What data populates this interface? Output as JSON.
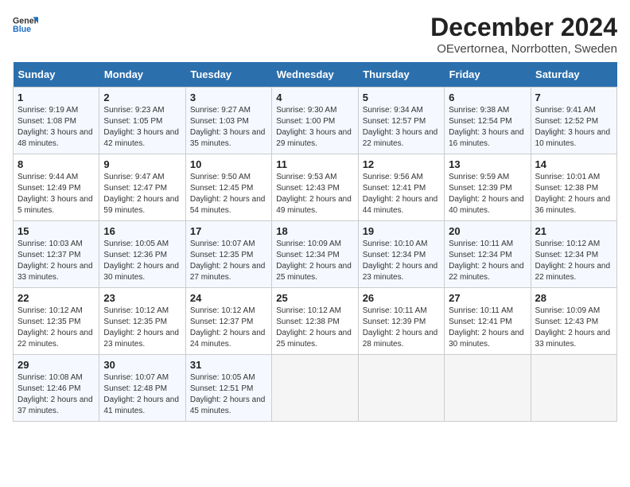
{
  "header": {
    "logo_general": "General",
    "logo_blue": "Blue",
    "title": "December 2024",
    "subtitle": "OEvertornea, Norrbotten, Sweden"
  },
  "columns": [
    "Sunday",
    "Monday",
    "Tuesday",
    "Wednesday",
    "Thursday",
    "Friday",
    "Saturday"
  ],
  "weeks": [
    [
      {
        "day": "1",
        "sunrise": "Sunrise: 9:19 AM",
        "sunset": "Sunset: 1:08 PM",
        "daylight": "Daylight: 3 hours and 48 minutes."
      },
      {
        "day": "2",
        "sunrise": "Sunrise: 9:23 AM",
        "sunset": "Sunset: 1:05 PM",
        "daylight": "Daylight: 3 hours and 42 minutes."
      },
      {
        "day": "3",
        "sunrise": "Sunrise: 9:27 AM",
        "sunset": "Sunset: 1:03 PM",
        "daylight": "Daylight: 3 hours and 35 minutes."
      },
      {
        "day": "4",
        "sunrise": "Sunrise: 9:30 AM",
        "sunset": "Sunset: 1:00 PM",
        "daylight": "Daylight: 3 hours and 29 minutes."
      },
      {
        "day": "5",
        "sunrise": "Sunrise: 9:34 AM",
        "sunset": "Sunset: 12:57 PM",
        "daylight": "Daylight: 3 hours and 22 minutes."
      },
      {
        "day": "6",
        "sunrise": "Sunrise: 9:38 AM",
        "sunset": "Sunset: 12:54 PM",
        "daylight": "Daylight: 3 hours and 16 minutes."
      },
      {
        "day": "7",
        "sunrise": "Sunrise: 9:41 AM",
        "sunset": "Sunset: 12:52 PM",
        "daylight": "Daylight: 3 hours and 10 minutes."
      }
    ],
    [
      {
        "day": "8",
        "sunrise": "Sunrise: 9:44 AM",
        "sunset": "Sunset: 12:49 PM",
        "daylight": "Daylight: 3 hours and 5 minutes."
      },
      {
        "day": "9",
        "sunrise": "Sunrise: 9:47 AM",
        "sunset": "Sunset: 12:47 PM",
        "daylight": "Daylight: 2 hours and 59 minutes."
      },
      {
        "day": "10",
        "sunrise": "Sunrise: 9:50 AM",
        "sunset": "Sunset: 12:45 PM",
        "daylight": "Daylight: 2 hours and 54 minutes."
      },
      {
        "day": "11",
        "sunrise": "Sunrise: 9:53 AM",
        "sunset": "Sunset: 12:43 PM",
        "daylight": "Daylight: 2 hours and 49 minutes."
      },
      {
        "day": "12",
        "sunrise": "Sunrise: 9:56 AM",
        "sunset": "Sunset: 12:41 PM",
        "daylight": "Daylight: 2 hours and 44 minutes."
      },
      {
        "day": "13",
        "sunrise": "Sunrise: 9:59 AM",
        "sunset": "Sunset: 12:39 PM",
        "daylight": "Daylight: 2 hours and 40 minutes."
      },
      {
        "day": "14",
        "sunrise": "Sunrise: 10:01 AM",
        "sunset": "Sunset: 12:38 PM",
        "daylight": "Daylight: 2 hours and 36 minutes."
      }
    ],
    [
      {
        "day": "15",
        "sunrise": "Sunrise: 10:03 AM",
        "sunset": "Sunset: 12:37 PM",
        "daylight": "Daylight: 2 hours and 33 minutes."
      },
      {
        "day": "16",
        "sunrise": "Sunrise: 10:05 AM",
        "sunset": "Sunset: 12:36 PM",
        "daylight": "Daylight: 2 hours and 30 minutes."
      },
      {
        "day": "17",
        "sunrise": "Sunrise: 10:07 AM",
        "sunset": "Sunset: 12:35 PM",
        "daylight": "Daylight: 2 hours and 27 minutes."
      },
      {
        "day": "18",
        "sunrise": "Sunrise: 10:09 AM",
        "sunset": "Sunset: 12:34 PM",
        "daylight": "Daylight: 2 hours and 25 minutes."
      },
      {
        "day": "19",
        "sunrise": "Sunrise: 10:10 AM",
        "sunset": "Sunset: 12:34 PM",
        "daylight": "Daylight: 2 hours and 23 minutes."
      },
      {
        "day": "20",
        "sunrise": "Sunrise: 10:11 AM",
        "sunset": "Sunset: 12:34 PM",
        "daylight": "Daylight: 2 hours and 22 minutes."
      },
      {
        "day": "21",
        "sunrise": "Sunrise: 10:12 AM",
        "sunset": "Sunset: 12:34 PM",
        "daylight": "Daylight: 2 hours and 22 minutes."
      }
    ],
    [
      {
        "day": "22",
        "sunrise": "Sunrise: 10:12 AM",
        "sunset": "Sunset: 12:35 PM",
        "daylight": "Daylight: 2 hours and 22 minutes."
      },
      {
        "day": "23",
        "sunrise": "Sunrise: 10:12 AM",
        "sunset": "Sunset: 12:35 PM",
        "daylight": "Daylight: 2 hours and 23 minutes."
      },
      {
        "day": "24",
        "sunrise": "Sunrise: 10:12 AM",
        "sunset": "Sunset: 12:37 PM",
        "daylight": "Daylight: 2 hours and 24 minutes."
      },
      {
        "day": "25",
        "sunrise": "Sunrise: 10:12 AM",
        "sunset": "Sunset: 12:38 PM",
        "daylight": "Daylight: 2 hours and 25 minutes."
      },
      {
        "day": "26",
        "sunrise": "Sunrise: 10:11 AM",
        "sunset": "Sunset: 12:39 PM",
        "daylight": "Daylight: 2 hours and 28 minutes."
      },
      {
        "day": "27",
        "sunrise": "Sunrise: 10:11 AM",
        "sunset": "Sunset: 12:41 PM",
        "daylight": "Daylight: 2 hours and 30 minutes."
      },
      {
        "day": "28",
        "sunrise": "Sunrise: 10:09 AM",
        "sunset": "Sunset: 12:43 PM",
        "daylight": "Daylight: 2 hours and 33 minutes."
      }
    ],
    [
      {
        "day": "29",
        "sunrise": "Sunrise: 10:08 AM",
        "sunset": "Sunset: 12:46 PM",
        "daylight": "Daylight: 2 hours and 37 minutes."
      },
      {
        "day": "30",
        "sunrise": "Sunrise: 10:07 AM",
        "sunset": "Sunset: 12:48 PM",
        "daylight": "Daylight: 2 hours and 41 minutes."
      },
      {
        "day": "31",
        "sunrise": "Sunrise: 10:05 AM",
        "sunset": "Sunset: 12:51 PM",
        "daylight": "Daylight: 2 hours and 45 minutes."
      },
      null,
      null,
      null,
      null
    ]
  ]
}
